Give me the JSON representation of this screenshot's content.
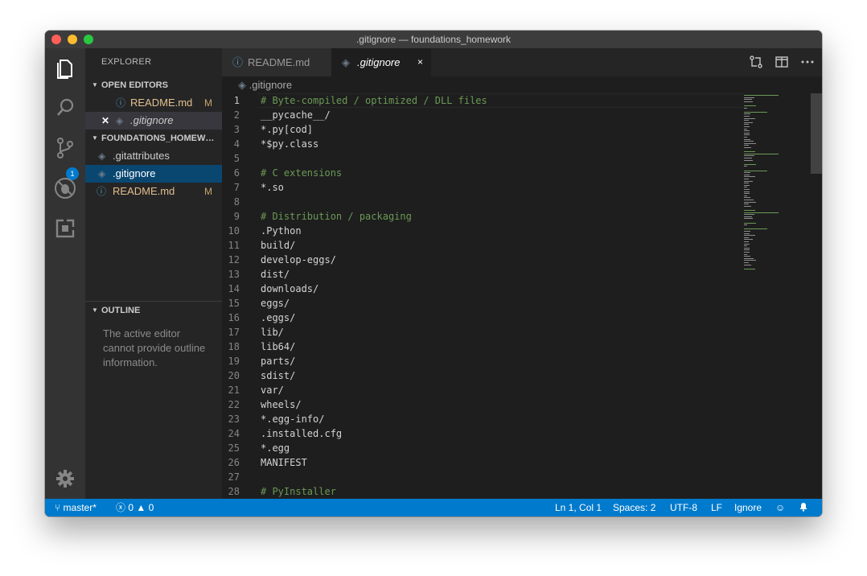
{
  "window": {
    "title": ".gitignore — foundations_homework"
  },
  "activity_bar": {
    "items": [
      {
        "name": "explorer-icon"
      },
      {
        "name": "search-icon"
      },
      {
        "name": "source-control-icon"
      },
      {
        "name": "debug-icon"
      },
      {
        "name": "extensions-icon"
      }
    ],
    "scm_badge": "1",
    "settings": "gear-icon"
  },
  "sidebar": {
    "title": "EXPLORER",
    "open_editors": {
      "label": "OPEN EDITORS",
      "items": [
        {
          "name": "README.md",
          "badge": "M"
        },
        {
          "name": ".gitignore"
        }
      ]
    },
    "folder": {
      "label": "FOUNDATIONS_HOMEWORK",
      "items": [
        {
          "name": ".gitattributes"
        },
        {
          "name": ".gitignore"
        },
        {
          "name": "README.md",
          "badge": "M"
        }
      ]
    },
    "outline": {
      "label": "OUTLINE",
      "message": "The active editor cannot provide outline information."
    }
  },
  "tabs": [
    {
      "label": "README.md"
    },
    {
      "label": ".gitignore",
      "close": "×"
    }
  ],
  "breadcrumb": ".gitignore",
  "code": [
    {
      "n": "1",
      "t": "# Byte-compiled / optimized / DLL files",
      "c": true
    },
    {
      "n": "2",
      "t": "__pycache__/"
    },
    {
      "n": "3",
      "t": "*.py[cod]"
    },
    {
      "n": "4",
      "t": "*$py.class"
    },
    {
      "n": "5",
      "t": ""
    },
    {
      "n": "6",
      "t": "# C extensions",
      "c": true
    },
    {
      "n": "7",
      "t": "*.so"
    },
    {
      "n": "8",
      "t": ""
    },
    {
      "n": "9",
      "t": "# Distribution / packaging",
      "c": true
    },
    {
      "n": "10",
      "t": ".Python"
    },
    {
      "n": "11",
      "t": "build/"
    },
    {
      "n": "12",
      "t": "develop-eggs/"
    },
    {
      "n": "13",
      "t": "dist/"
    },
    {
      "n": "14",
      "t": "downloads/"
    },
    {
      "n": "15",
      "t": "eggs/"
    },
    {
      "n": "16",
      "t": ".eggs/"
    },
    {
      "n": "17",
      "t": "lib/"
    },
    {
      "n": "18",
      "t": "lib64/"
    },
    {
      "n": "19",
      "t": "parts/"
    },
    {
      "n": "20",
      "t": "sdist/"
    },
    {
      "n": "21",
      "t": "var/"
    },
    {
      "n": "22",
      "t": "wheels/"
    },
    {
      "n": "23",
      "t": "*.egg-info/"
    },
    {
      "n": "24",
      "t": ".installed.cfg"
    },
    {
      "n": "25",
      "t": "*.egg"
    },
    {
      "n": "26",
      "t": "MANIFEST"
    },
    {
      "n": "27",
      "t": ""
    },
    {
      "n": "28",
      "t": "# PyInstaller",
      "c": true
    }
  ],
  "status": {
    "branch": "master*",
    "errors": "0",
    "warnings": "0",
    "position": "Ln 1, Col 1",
    "spaces": "Spaces: 2",
    "encoding": "UTF-8",
    "eol": "LF",
    "language": "Ignore"
  },
  "colors": {
    "accent": "#007acc",
    "comment": "#6a9955",
    "modified": "#c5a66d",
    "selection": "#094771"
  }
}
